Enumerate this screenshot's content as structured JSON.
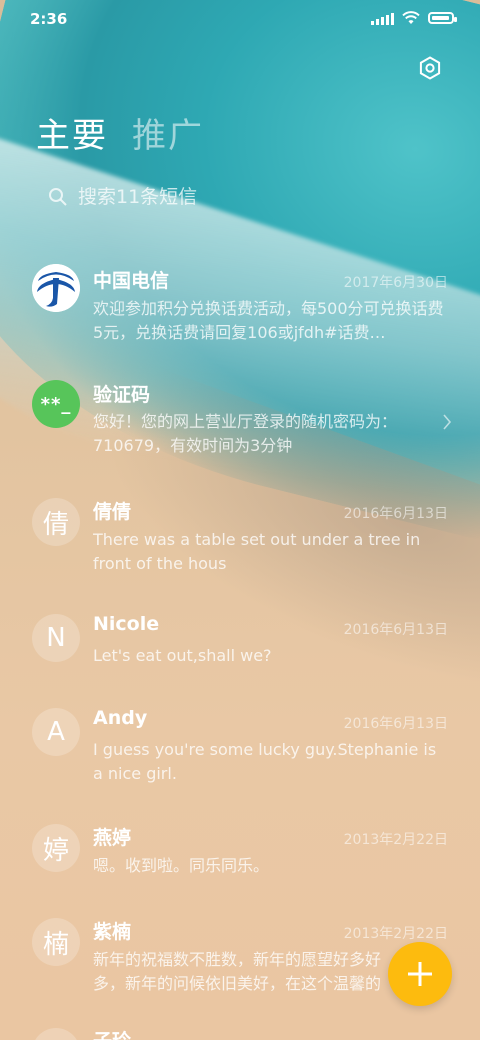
{
  "status_bar": {
    "time": "2:36"
  },
  "tabs": [
    {
      "label": "主要",
      "active": true
    },
    {
      "label": "推广",
      "active": false
    }
  ],
  "search": {
    "placeholder": "搜索11条短信"
  },
  "conversations": [
    {
      "name": "中国电信",
      "date": "2017年6月30日",
      "preview": "欢迎参加积分兑换话费活动，每500分可兑换话费5元，兑换话费请回复106或jfdh#话费…",
      "avatar": "china-telecom-logo"
    },
    {
      "name": "验证码",
      "date": "",
      "preview": "您好！您的网上营业厅登录的随机密码为：710679，有效时间为3分钟",
      "avatar_text": "**_"
    },
    {
      "name": "倩倩",
      "date": "2016年6月13日",
      "preview": "There was a table set out under a tree in front of the hous",
      "avatar_text": "倩"
    },
    {
      "name": "Nicole",
      "date": "2016年6月13日",
      "preview": "Let's eat out,shall we?",
      "avatar_text": "N"
    },
    {
      "name": "Andy",
      "date": "2016年6月13日",
      "preview": "I guess you're some lucky guy.Stephanie is a nice girl.",
      "avatar_text": "A"
    },
    {
      "name": "燕婷",
      "date": "2013年2月22日",
      "preview": "嗯。收到啦。同乐同乐。",
      "avatar_text": "婷"
    },
    {
      "name": "紫楠",
      "date": "2013年2月22日",
      "preview": "新年的祝福数不胜数，新年的愿望好多好多，新年的问候依旧美好，在这个温馨的时刻",
      "avatar_text": "楠"
    },
    {
      "name": "子玲",
      "date": "",
      "preview": "",
      "avatar_text": "玲"
    }
  ],
  "colors": {
    "fab": "#fdbb0e",
    "verify_avatar": "#57c55a",
    "telecom_blue": "#1a56a8"
  },
  "icons": {
    "settings": "settings-icon",
    "search": "search-icon",
    "compose": "plus-icon"
  }
}
